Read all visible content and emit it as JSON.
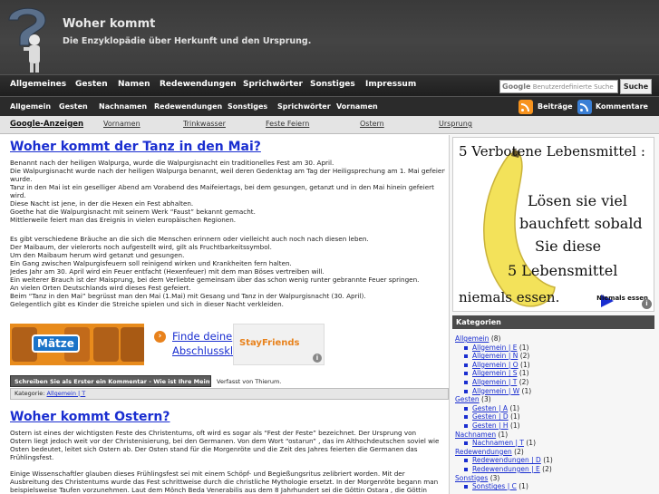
{
  "header": {
    "title": "Woher kommt",
    "subtitle": "Die Enzyklopädie über Herkunft und den Ursprung."
  },
  "nav1": {
    "items": [
      "Allgemeines",
      "Gesten",
      "Namen",
      "Redewendungen",
      "Sprichwörter",
      "Sonstiges",
      "Impressum"
    ],
    "search_brand": "Google",
    "search_placeholder": "Benutzerdefinierte Suche",
    "search_button": "Suche"
  },
  "nav2": {
    "items": [
      "Allgemein",
      "Gesten",
      "Nachnamen",
      "Redewendungen",
      "Sonstiges",
      "Sprichwörter",
      "Vornamen"
    ],
    "feed_posts": "Beiträge",
    "feed_comments": "Kommentare"
  },
  "nav3": {
    "label": "Google-Anzeigen",
    "items": [
      "Vornamen",
      "Trinkwasser",
      "Feste Feiern",
      "Ostern",
      "Ursprung"
    ]
  },
  "post1": {
    "title": "Woher kommt der Tanz in den Mai?",
    "block1": [
      "Benannt nach der heiligen Walpurga, wurde die Walpurgisnacht ein traditionelles Fest am 30. April.",
      "Die Walpurgisnacht wurde nach der heiligen Walpurga benannt, weil deren Gedenktag am Tag der Heiligsprechung am 1. Mai gefeiert",
      "wurde.",
      "Tanz in den Mai ist ein geselliger Abend am Vorabend des Maifeiertags, bei dem gesungen, getanzt und in den Mai hinein gefeiert",
      "wird.",
      "Diese Nacht ist jene, in der die Hexen ein Fest abhalten.",
      "Goethe hat die Walpurgisnacht mit seinem Werk “Faust” bekannt gemacht.",
      "Mittlerweile feiert man das Ereignis in vielen europäischen Regionen."
    ],
    "block2": [
      "Es gibt verschiedene Bräuche an die sich die Menschen erinnern oder vielleicht auch noch nach diesen leben.",
      "Der Maibaum, der vielerorts noch aufgestellt wird, gilt als Fruchtbarkeitssymbol.",
      "Um den Maibaum herum wird getanzt und gesungen.",
      "Ein Gang zwischen Walpurgisfeuern soll reinigend wirken und Krankheiten fern halten.",
      "Jedes Jahr am 30. April wird ein Feuer entfacht (Hexenfeuer) mit dem man Böses vertreiben will.",
      "Ein weiterer Brauch ist der Maisprung, bei dem Verliebte gemeinsam über das schon wenig runter gebrannte Feuer springen.",
      "An vielen Orten Deutschlands wird dieses Fest gefeiert.",
      "Beim “Tanz in den Mai” begrüsst man den Mai (1.Mai) mit Gesang und Tanz in der Walpurgisnacht (30. April).",
      "Gelegentlich gibt es Kinder die Streiche spielen und sich in dieser Nacht verkleiden."
    ],
    "ad1_badge": "Mätze",
    "ad1_text_line1": "Finde deine",
    "ad1_text_line2": "Abschlussklasse",
    "ad2_logo": "StayFriends",
    "comment_link": "Schreiben Sie als Erster ein Kommentar - Wie ist Ihre Meinung?",
    "author": "Verfasst von Thierum.",
    "category_label": "Kategorie:",
    "category_value": "Allgemein | T"
  },
  "post2": {
    "title": "Woher kommt Ostern?",
    "block1": [
      "Ostern ist eines der wichtigsten Feste des Christentums, oft wird es sogar als “Fest der Feste” bezeichnet. Der Ursprung von",
      "Ostern liegt jedoch weit vor der Christenisierung, bei den Germanen. Von dem Wort “ostarun” , das im Althochdeutschen soviel wie",
      "Osten bedeutet, leitet sich Ostern ab. Der Osten stand für die Morgenröte und die Zeit des Jahres feierten die Germanen das",
      "Frühlingsfest."
    ],
    "block2": [
      "Einige Wissenschaftler glauben dieses Frühlingsfest sei mit einem Schöpf- und Begießungsritus zelibriert worden. Mit der",
      "Ausbreitung des Christentums wurde das Fest schrittweise durch die christliche Mythologie ersetzt. In der Morgenröte begann man",
      "beispielsweise Taufen vorzunehmen. Laut dem Mönch Beda Venerabilis aus dem 8 Jahrhundert sei die Göttin Ostara , die Göttin"
    ]
  },
  "sidebar": {
    "banner_lines": [
      "5 Verbotene Lebensmittel :",
      "Lösen sie viel",
      "bauchfett sobald",
      "Sie diese",
      "5 Lebensmittel",
      "niemals essen."
    ],
    "banner_more": "Niemals essen",
    "categories_title": "Kategorien",
    "categories": [
      {
        "label": "Allgemein",
        "count": "(8)",
        "sub": false
      },
      {
        "label": "Allgemein | E",
        "count": "(1)",
        "sub": true
      },
      {
        "label": "Allgemein | N",
        "count": "(2)",
        "sub": true
      },
      {
        "label": "Allgemein | O",
        "count": "(1)",
        "sub": true
      },
      {
        "label": "Allgemein | S",
        "count": "(1)",
        "sub": true
      },
      {
        "label": "Allgemein | T",
        "count": "(2)",
        "sub": true
      },
      {
        "label": "Allgemein | W",
        "count": "(1)",
        "sub": true
      },
      {
        "label": "Gesten",
        "count": "(3)",
        "sub": false
      },
      {
        "label": "Gesten | A",
        "count": "(1)",
        "sub": true
      },
      {
        "label": "Gesten | D",
        "count": "(1)",
        "sub": true
      },
      {
        "label": "Gesten | H",
        "count": "(1)",
        "sub": true
      },
      {
        "label": "Nachnamen",
        "count": "(1)",
        "sub": false
      },
      {
        "label": "Nachnamen | T",
        "count": "(1)",
        "sub": true
      },
      {
        "label": "Redewendungen",
        "count": "(2)",
        "sub": false
      },
      {
        "label": "Redewendungen | D",
        "count": "(1)",
        "sub": true
      },
      {
        "label": "Redewendungen | E",
        "count": "(2)",
        "sub": true
      },
      {
        "label": "Sonstiges",
        "count": "(3)",
        "sub": false
      },
      {
        "label": "Sonstiges | C",
        "count": "(1)",
        "sub": true
      }
    ]
  }
}
